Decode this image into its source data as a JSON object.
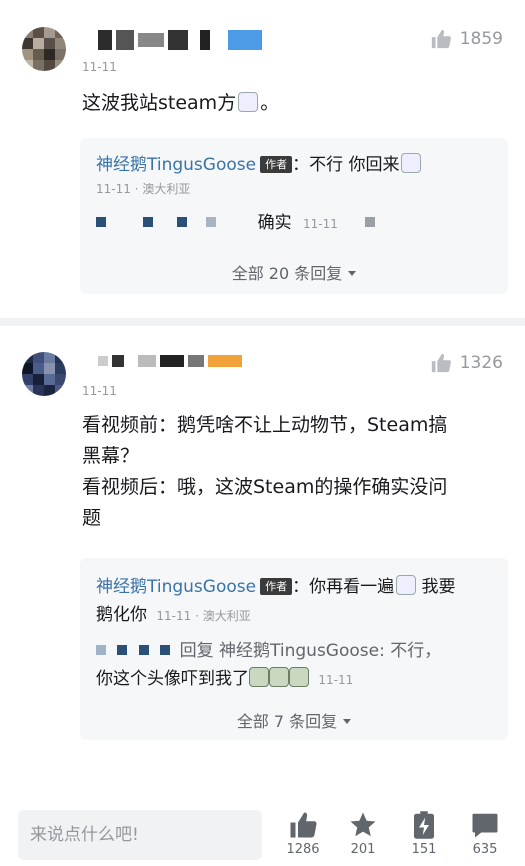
{
  "comments": [
    {
      "date": "11-11",
      "likes": "1859",
      "text": "这波我站steam方",
      "text_suffix": "。",
      "reply_box": {
        "line1_name": "神经鹅TingusGoose",
        "line1_tag": "作者",
        "line1_text": "：不行 你回来",
        "line1_meta": "11-11 · 澳大利亚",
        "line2_text": "确实",
        "line2_date": "11-11",
        "more_label": "全部 20 条回复"
      }
    },
    {
      "date": "11-11",
      "likes": "1326",
      "text_lines": [
        "看视频前：鹅凭啥不让上动物节，Steam搞",
        "黑幕？",
        "看视频后：哦，这波Steam的操作确实没问",
        "题"
      ],
      "reply_box": {
        "line1_name": "神经鹅TingusGoose",
        "line1_tag": "作者",
        "line1_text": "：你再看一遍",
        "line1_text_after": " 我要",
        "line1b_text": "鹅化你",
        "line1b_meta": "11-11 · 澳大利亚",
        "line2_reply_prefix": "回复 神经鹅TingusGoose: 不行，",
        "line3_text": "你这个头像吓到我了",
        "line3_date": "11-11",
        "more_label": "全部 7 条回复"
      }
    }
  ],
  "bottom_bar": {
    "input_placeholder": "来说点什么吧!",
    "like_count": "1286",
    "favorite_count": "201",
    "charge_count": "151",
    "comment_count": "635"
  },
  "icons": {
    "like": "thumbs-up-icon",
    "favorite": "star-icon",
    "charge": "battery-bolt-icon",
    "comment": "chat-bubble-icon"
  }
}
